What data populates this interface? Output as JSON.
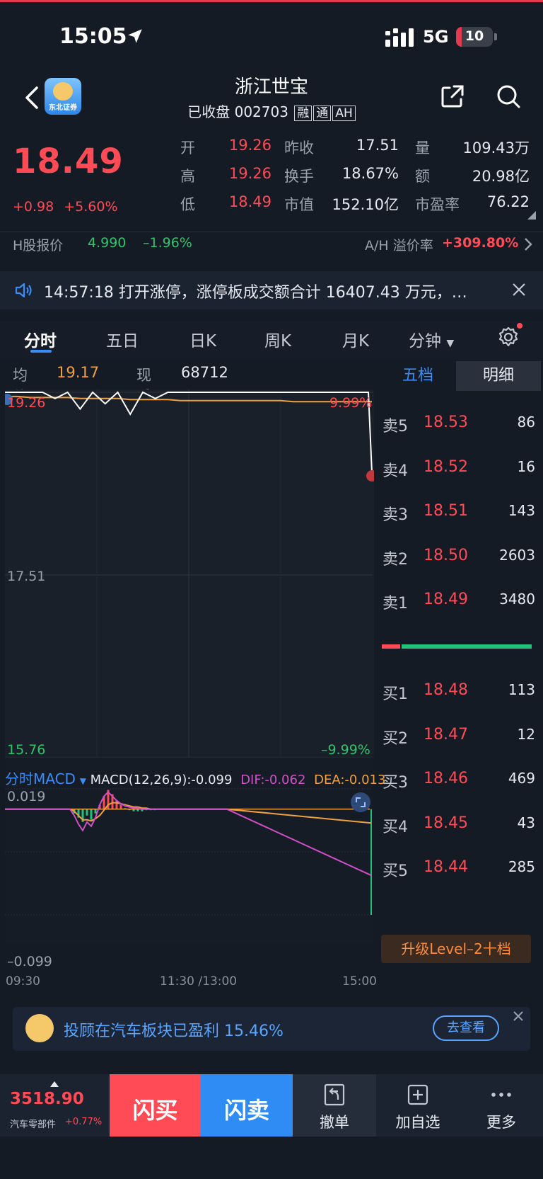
{
  "status": {
    "time": "15:05",
    "network": "5G",
    "battery": "10"
  },
  "header": {
    "title": "浙江世宝",
    "state": "已收盘",
    "code": "002703",
    "tags": [
      "融",
      "通",
      "AH"
    ],
    "logo_text": "东北证券"
  },
  "quote": {
    "price": "18.49",
    "change": "+0.98",
    "change_pct": "+5.60%",
    "rows": [
      [
        {
          "l": "开",
          "v": "19.26",
          "c": "#ff4b55"
        },
        {
          "l": "昨收",
          "v": "17.51",
          "c": "#e6e9ef"
        },
        {
          "l": "量",
          "v": "109.43万",
          "c": "#e6e9ef"
        }
      ],
      [
        {
          "l": "高",
          "v": "19.26",
          "c": "#ff4b55"
        },
        {
          "l": "换手",
          "v": "18.67%",
          "c": "#e6e9ef"
        },
        {
          "l": "额",
          "v": "20.98亿",
          "c": "#e6e9ef"
        }
      ],
      [
        {
          "l": "低",
          "v": "18.49",
          "c": "#ff4b55"
        },
        {
          "l": "市值",
          "v": "152.10亿",
          "c": "#e6e9ef"
        },
        {
          "l": "市盈率",
          "v": "76.22",
          "c": "#e6e9ef"
        }
      ]
    ]
  },
  "hshare": {
    "label": "H股报价",
    "price": "4.990",
    "change": "–1.96%",
    "ah_label": "A/H 溢价率",
    "ah_value": "+309.80%"
  },
  "news": {
    "text": "14:57:18 打开涨停，涨停板成交额合计 16407.43 万元，…"
  },
  "tabs": [
    "分时",
    "五日",
    "日K",
    "周K",
    "月K",
    "分钟"
  ],
  "chart_info": {
    "avg_label": "均价",
    "avg_value": "19.17",
    "vol_label": "现手",
    "vol_value": "68712"
  },
  "chart_data": {
    "type": "line",
    "price_axis": {
      "top": "19.26",
      "mid": "17.51",
      "bottom": "15.76",
      "top_pct": "9.99%",
      "bottom_pct": "–9.99%"
    },
    "ylim": [
      15.76,
      19.26
    ],
    "x_labels": [
      "09:30",
      "11:30 /13:00",
      "15:00"
    ],
    "price_series": [
      19.26,
      19.26,
      19.26,
      19.26,
      19.2,
      19.26,
      19.1,
      19.26,
      19.15,
      19.26,
      19.05,
      19.26,
      19.2,
      19.26,
      19.26,
      19.26,
      19.26,
      19.26,
      19.26,
      19.26,
      19.26,
      19.26,
      19.26,
      19.26,
      19.26,
      19.26,
      19.26,
      19.26,
      19.26,
      19.26,
      18.49
    ],
    "avg_series": [
      19.22,
      19.22,
      19.21,
      19.21,
      19.21,
      19.21,
      19.2,
      19.2,
      19.2,
      19.2,
      19.19,
      19.19,
      19.19,
      19.19,
      19.18,
      19.18,
      19.18,
      19.18,
      19.18,
      19.18,
      19.18,
      19.18,
      19.18,
      19.17,
      19.17,
      19.17,
      19.17,
      19.17,
      19.17,
      19.17,
      19.17
    ],
    "macd": {
      "title": "分时MACD",
      "params": "MACD(12,26,9):-0.099",
      "dif": "DIF:-0.062",
      "dea": "DEA:-0.013",
      "ymax": "0.019",
      "ymin": "–0.099",
      "ylim": [
        -0.099,
        0.019
      ],
      "bars": [
        0,
        0,
        0,
        -0.004,
        -0.008,
        -0.012,
        -0.006,
        -0.01,
        -0.004,
        0.004,
        0.012,
        0.018,
        0.014,
        0.008,
        0.004,
        0.001,
        -0.001,
        -0.002,
        -0.002,
        -0.002,
        -0.001,
        -0.001,
        -0.001,
        0,
        0,
        0,
        0,
        0,
        0,
        0,
        0,
        0,
        0,
        0,
        0,
        0,
        0,
        0,
        0,
        0,
        -0.099
      ],
      "dif_series": [
        0,
        0,
        0,
        -0.006,
        -0.014,
        -0.02,
        -0.012,
        -0.016,
        -0.008,
        0.004,
        0.012,
        0.016,
        0.012,
        0.008,
        0.005,
        0.003,
        0.002,
        0.001,
        0.001,
        0,
        0,
        0,
        0,
        0,
        0,
        0,
        0,
        0,
        0,
        0,
        0,
        0,
        0,
        0,
        0,
        0,
        0,
        0,
        0,
        0,
        -0.062
      ],
      "dea_series": [
        0,
        0,
        0,
        -0.002,
        -0.006,
        -0.01,
        -0.01,
        -0.011,
        -0.009,
        -0.006,
        -0.001,
        0.004,
        0.006,
        0.006,
        0.005,
        0.004,
        0.003,
        0.002,
        0.002,
        0.001,
        0.001,
        0,
        0,
        0,
        0,
        0,
        0,
        0,
        0,
        0,
        0,
        0,
        0,
        0,
        0,
        0,
        0,
        0,
        0,
        0,
        -0.013
      ]
    }
  },
  "orderbook": {
    "tabs": [
      "五档",
      "明细"
    ],
    "sells": [
      {
        "l": "卖5",
        "p": "18.53",
        "v": "86"
      },
      {
        "l": "卖4",
        "p": "18.52",
        "v": "16"
      },
      {
        "l": "卖3",
        "p": "18.51",
        "v": "143"
      },
      {
        "l": "卖2",
        "p": "18.50",
        "v": "2603"
      },
      {
        "l": "卖1",
        "p": "18.49",
        "v": "3480"
      }
    ],
    "buys": [
      {
        "l": "买1",
        "p": "18.48",
        "v": "113"
      },
      {
        "l": "买2",
        "p": "18.47",
        "v": "12"
      },
      {
        "l": "买3",
        "p": "18.46",
        "v": "469"
      },
      {
        "l": "买4",
        "p": "18.45",
        "v": "43"
      },
      {
        "l": "买5",
        "p": "18.44",
        "v": "285"
      }
    ],
    "upgrade": "升级Level–2十档"
  },
  "promo": {
    "text": "投顾在汽车板块已盈利 15.46%",
    "button": "去查看"
  },
  "bottom": {
    "index_value": "3518.90",
    "index_name": "汽车零部件",
    "index_change": "+0.77%",
    "buy": "闪买",
    "sell": "闪卖",
    "cancel": "撤单",
    "watch": "加自选",
    "more": "更多"
  },
  "colors": {
    "up": "#ff4b55",
    "down": "#2fc46c",
    "accent": "#2f8cf5",
    "avg": "#f0a040"
  }
}
